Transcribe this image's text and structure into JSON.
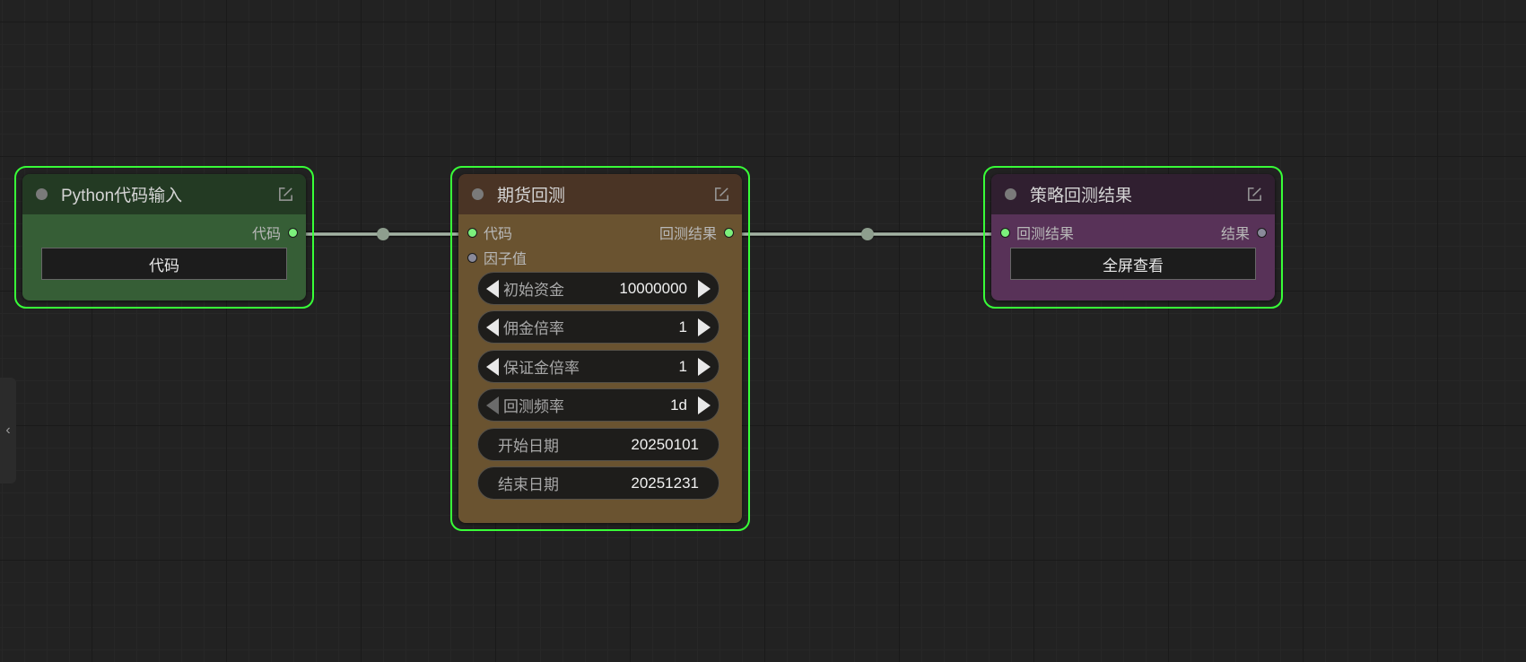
{
  "colors": {
    "canvas": "#222222",
    "selection_outline": "#38ff38",
    "link": "#a4b3a4",
    "slot_connected": "#7cf07c",
    "slot_unconnected": "#8a8a9a"
  },
  "sidebar": {
    "toggle_glyph": "‹",
    "toggle_icon": "chevron-left-icon"
  },
  "nodes": {
    "python_input": {
      "title": "Python代码输入",
      "header_color": "#233a23",
      "body_color": "#365e36",
      "outputs": [
        {
          "label": "代码",
          "connected": true
        }
      ],
      "button_label": "代码"
    },
    "futures_backtest": {
      "title": "期货回测",
      "header_color": "#4a3425",
      "body_color": "#6a5330",
      "inputs": [
        {
          "label": "代码",
          "connected": true
        },
        {
          "label": "因子值",
          "connected": false
        }
      ],
      "outputs": [
        {
          "label": "回测结果",
          "connected": true
        }
      ],
      "widgets": [
        {
          "label": "初始资金",
          "value": "10000000",
          "type": "number"
        },
        {
          "label": "佣金倍率",
          "value": "1",
          "type": "number"
        },
        {
          "label": "保证金倍率",
          "value": "1",
          "type": "number"
        },
        {
          "label": "回测频率",
          "value": "1d",
          "type": "combo"
        },
        {
          "label": "开始日期",
          "value": "20250101",
          "type": "text"
        },
        {
          "label": "结束日期",
          "value": "20251231",
          "type": "text"
        }
      ]
    },
    "strategy_result": {
      "title": "策略回测结果",
      "header_color": "#301f30",
      "body_color": "#583258",
      "inputs": [
        {
          "label": "回测结果",
          "connected": true
        }
      ],
      "outputs": [
        {
          "label": "结果",
          "connected": false
        }
      ],
      "button_label": "全屏查看"
    }
  }
}
